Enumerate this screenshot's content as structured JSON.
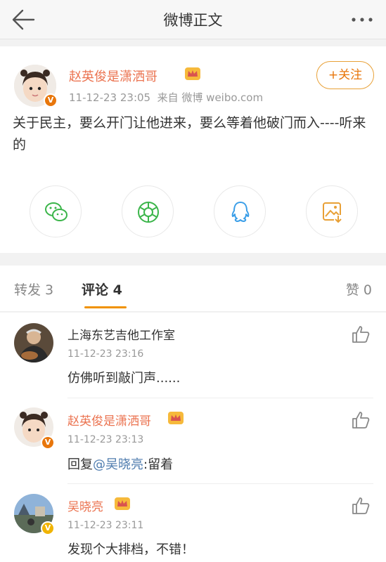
{
  "topbar": {
    "title": "微博正文",
    "back_icon": "arrow-left-icon",
    "more_icon": "more-dots-icon"
  },
  "post": {
    "author": "赵英俊是潇洒哥",
    "time": "11-12-23 23:05",
    "source": "来自 微博 weibo.com",
    "follow_label": "+关注",
    "text": "关于民主，要么开门让他进来，要么等着他破门而入----听来的",
    "share": [
      {
        "name": "wechat",
        "icon": "wechat-icon",
        "color": "#3bb54a"
      },
      {
        "name": "moments",
        "icon": "moments-icon",
        "color": "#3bb54a"
      },
      {
        "name": "qq",
        "icon": "qq-icon",
        "color": "#3a9ee8"
      },
      {
        "name": "save-image",
        "icon": "save-image-icon",
        "color": "#e8a036"
      }
    ]
  },
  "tabs": {
    "repost": "转发 3",
    "comments": "评论 4",
    "likes": "赞 0"
  },
  "comments": [
    {
      "name": "上海东艺吉他工作室",
      "name_color": "#333333",
      "time": "11-12-23 23:16",
      "text": "仿佛听到敲门声......",
      "crown": false
    },
    {
      "name": "赵英俊是潇洒哥",
      "name_color": "#eb7350",
      "time": "11-12-23 23:13",
      "reply_prefix": "回复",
      "mention": "@吴晓亮",
      "reply_text": ":留着",
      "crown": true
    },
    {
      "name": "吴晓亮",
      "name_color": "#eb7350",
      "time": "11-12-23 23:11",
      "text": "发现个大排档，不错！",
      "crown": true
    }
  ],
  "colors": {
    "accent": "#eb7350",
    "follow": "#e8760b",
    "tab_underline": "#f09200",
    "mention": "#507daf"
  }
}
